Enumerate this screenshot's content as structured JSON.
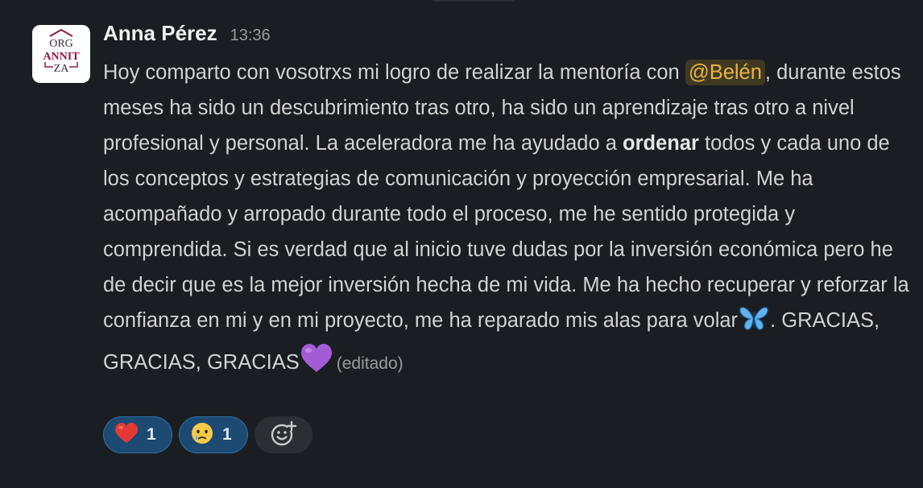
{
  "message": {
    "author": "Anna Pérez",
    "timestamp": "13:36",
    "avatar_text": "ORG ANNIT ZA",
    "text_part_1": "Hoy comparto con vosotrxs mi logro de realizar la mentoría con ",
    "mention": "@Belén",
    "text_part_2": ", durante estos meses ha sido un descubrimiento tras otro, ha sido un aprendizaje tras otro a nivel profesional y personal. La aceleradora me ha ayudado a ",
    "bold_word": "ordenar",
    "text_part_3": " todos y cada uno de los conceptos y estrategias de comunicación y proyección empresarial. Me ha acompañado y arropado durante todo el proceso, me he sentido protegida y comprendida. Si es verdad que al inicio tuve dudas por la inversión económica pero he de decir que es la mejor inversión hecha de mi vida. Me ha hecho recuperar y reforzar la confianza en mi y en mi proyecto, me ha reparado mis alas para volar",
    "text_part_4": ". GRACIAS, GRACIAS, GRACIAS",
    "edited_label": "(editado)",
    "inline_emojis": [
      "butterfly-icon",
      "purple-heart-icon"
    ]
  },
  "reactions": [
    {
      "emoji": "red-heart-icon",
      "count": "1",
      "active": true
    },
    {
      "emoji": "crying-face-icon",
      "count": "1",
      "active": true
    }
  ],
  "add_reaction": {
    "icon": "add-reaction-icon"
  },
  "colors": {
    "background": "#1a1d21",
    "mention_bg": "#3f3922",
    "mention_text": "#e8b53b",
    "reaction_active": "#1c4a73",
    "avatar_accent": "#8b1a4a"
  }
}
